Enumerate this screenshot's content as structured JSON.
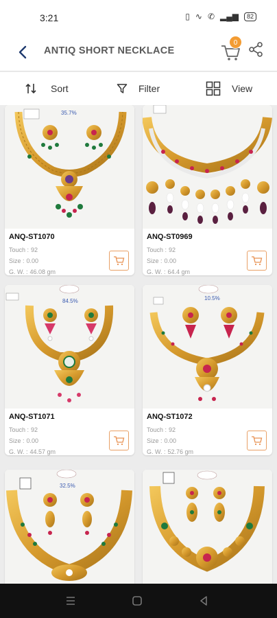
{
  "status_bar": {
    "time": "3:21",
    "icons": [
      "vibrate-icon",
      "wifi-icon",
      "volte-icon",
      "signal-icon"
    ],
    "battery": "82"
  },
  "header": {
    "title": "ANTIQ SHORT NECKLACE",
    "cart_count": "0"
  },
  "toolbar": {
    "sort_label": "Sort",
    "filter_label": "Filter",
    "view_label": "View"
  },
  "meta_labels": {
    "touch": "Touch :",
    "size": "Size :",
    "gw": "G. W. :"
  },
  "products": [
    {
      "sku": "ANQ-ST1070",
      "touch": "92",
      "size": "0.00",
      "gross_weight": "46.08 gm",
      "tag": "35.7%"
    },
    {
      "sku": "ANQ-ST0969",
      "touch": "92",
      "size": "0.00",
      "gross_weight": "64.4 gm",
      "tag": ""
    },
    {
      "sku": "ANQ-ST1071",
      "touch": "92",
      "size": "0.00",
      "gross_weight": "44.57 gm",
      "tag": "84.5%"
    },
    {
      "sku": "ANQ-ST1072",
      "touch": "92",
      "size": "0.00",
      "gross_weight": "52.76 gm",
      "tag": "10.5%"
    },
    {
      "sku": "",
      "touch": "",
      "size": "",
      "gross_weight": "",
      "tag": "32.5%"
    },
    {
      "sku": "",
      "touch": "",
      "size": "",
      "gross_weight": "",
      "tag": ""
    }
  ],
  "colors": {
    "gold": "#d9a53b",
    "gold_dark": "#b3801f",
    "emerald": "#1f7a3d",
    "ruby": "#c7244e",
    "accent_orange": "#f39c33",
    "title_gray": "#5a5a5a"
  }
}
